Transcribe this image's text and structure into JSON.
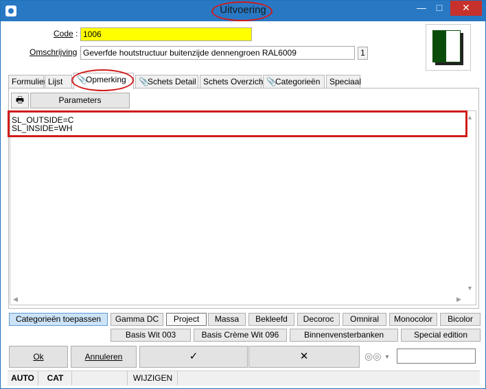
{
  "window": {
    "title": "Uitvoering"
  },
  "form": {
    "code_label": "Code",
    "code_value": "1006",
    "omschrijving_label": "Omschrijving",
    "omschrijving_value": "Geverfde houtstructuur buitenzijde dennengroen RAL6009",
    "count": "1",
    "colon": ":"
  },
  "tabs": [
    {
      "label": "Formulier",
      "clip": false
    },
    {
      "label": "Lijst",
      "clip": false
    },
    {
      "label": "Opmerking",
      "clip": true
    },
    {
      "label": "Schets Detail",
      "clip": true
    },
    {
      "label": "Schets Overzicht",
      "clip": false
    },
    {
      "label": "Categorieën",
      "clip": true
    },
    {
      "label": "Speciaal",
      "clip": false
    }
  ],
  "toolbar": {
    "print_icon": "printer-icon",
    "parameters_label": "Parameters"
  },
  "memo": {
    "lines": [
      "SL_OUTSIDE=C",
      "SL_INSIDE=WH"
    ]
  },
  "category_buttons": {
    "row1": [
      "Categorieën toepassen",
      "Gamma DC",
      "Project",
      "Massa",
      "Bekleefd",
      "Decoroc",
      "Omniral",
      "Monocolor",
      "Bicolor"
    ],
    "row2": [
      "Basis Wit 003",
      "Basis Crème Wit 096",
      "Binnenvensterbanken",
      "Special edition"
    ]
  },
  "actions": {
    "ok": "Ok",
    "cancel": "Annuleren",
    "check": "✓",
    "cross": "✕",
    "binoculars": "binoculars-icon"
  },
  "status": {
    "mode": "AUTO",
    "cat": "CAT",
    "state": "WIJZIGEN"
  },
  "colors": {
    "title_bar": "#2878c4",
    "highlight": "#d11a1a",
    "code_bg": "#ffff00",
    "preview_green": "#0a4d0a"
  }
}
